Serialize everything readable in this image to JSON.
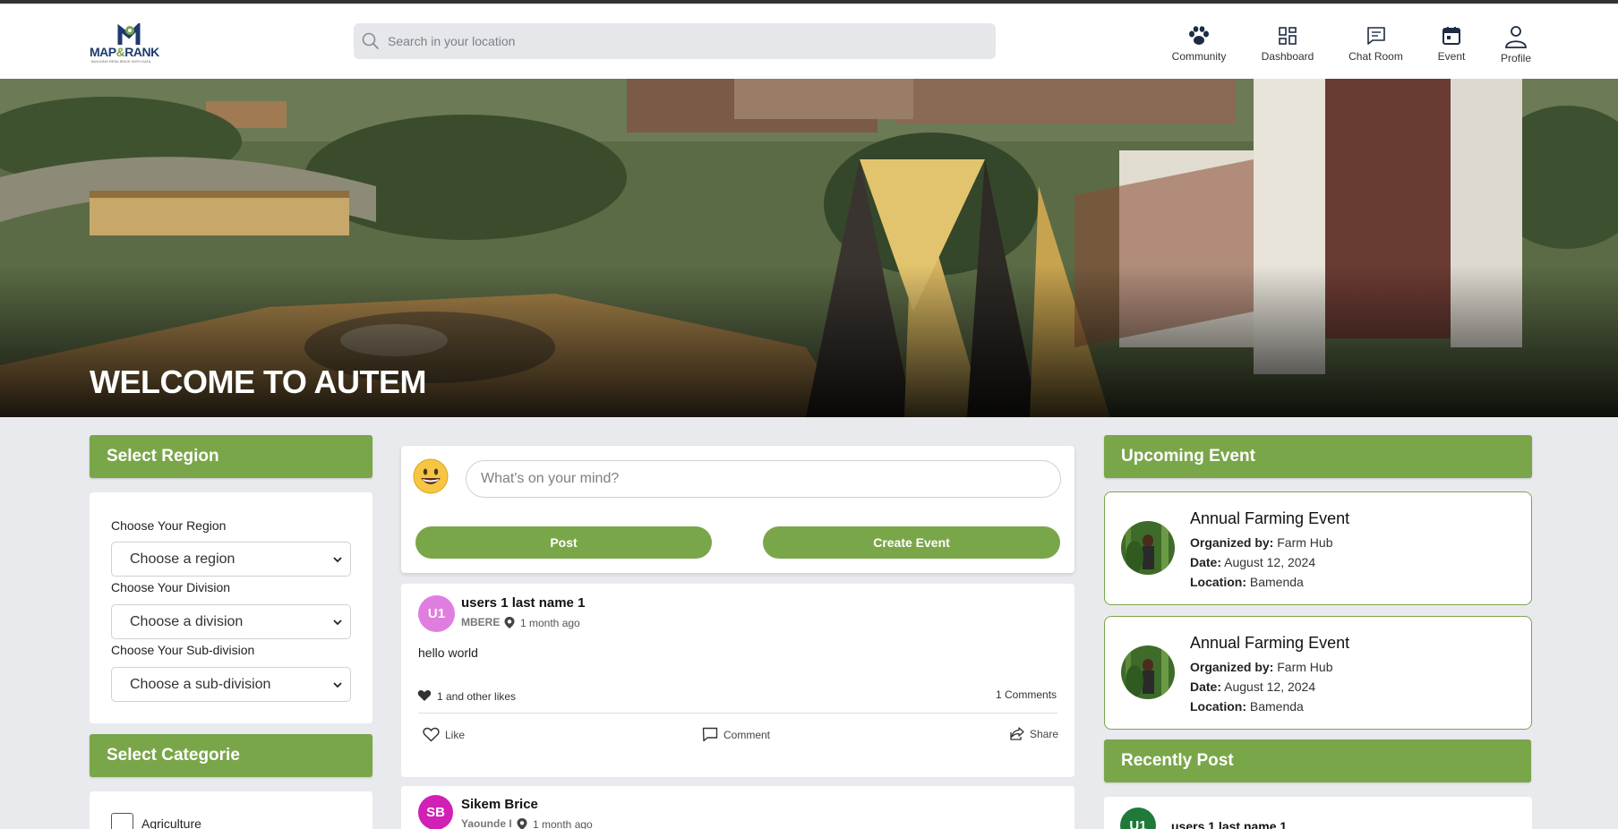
{
  "header": {
    "logo_text": "MAP&RANK",
    "logo_tagline": "BUILDING RESILIENCE WITH DATA",
    "search_placeholder": "Search in your location",
    "nav": [
      {
        "label": "Community",
        "icon": "paw-icon"
      },
      {
        "label": "Dashboard",
        "icon": "grid-icon"
      },
      {
        "label": "Chat Room",
        "icon": "chat-icon"
      },
      {
        "label": "Event",
        "icon": "calendar-icon"
      },
      {
        "label": "Profile",
        "icon": "user-icon"
      }
    ]
  },
  "hero": {
    "title": "WELCOME TO AUTEM"
  },
  "left": {
    "region_heading": "Select Region",
    "region_label": "Choose Your Region",
    "region_value": "Choose a region",
    "division_label": "Choose Your Division",
    "division_value": "Choose a division",
    "subdivision_label": "Choose Your Sub-division",
    "subdivision_value": "Choose a sub-division",
    "category_heading": "Select Categorie",
    "categories": [
      "Agriculture"
    ]
  },
  "composer": {
    "placeholder": "What's on your mind?",
    "post_label": "Post",
    "event_label": "Create Event"
  },
  "posts": [
    {
      "initials": "U1",
      "avatar_color": "#e07ee0",
      "author": "users 1 last name 1",
      "location": "MBERE",
      "time": "1 month ago",
      "body": "hello world",
      "likes": "1 and other likes",
      "comments": "1 Comments",
      "like_label": "Like",
      "comment_label": "Comment",
      "share_label": "Share"
    },
    {
      "initials": "SB",
      "avatar_color": "#d21fb6",
      "author": "Sikem Brice",
      "location": "Yaounde I",
      "time": "1 month ago"
    }
  ],
  "right": {
    "upcoming_heading": "Upcoming Event",
    "events": [
      {
        "title": "Annual Farming Event",
        "org_label": "Organized by:",
        "org": "Farm Hub",
        "date_label": "Date:",
        "date": "August 12, 2024",
        "loc_label": "Location:",
        "location": "Bamenda"
      },
      {
        "title": "Annual Farming Event",
        "org_label": "Organized by:",
        "org": "Farm Hub",
        "date_label": "Date:",
        "date": "August 12, 2024",
        "loc_label": "Location:",
        "location": "Bamenda"
      }
    ],
    "recent_heading": "Recently Post",
    "recent": [
      {
        "initials": "U1",
        "avatar_color": "#1f7a3a",
        "author": "users 1 last name 1"
      }
    ]
  },
  "colors": {
    "accent": "#7aa64a",
    "brand_blue": "#1d3b6e"
  }
}
